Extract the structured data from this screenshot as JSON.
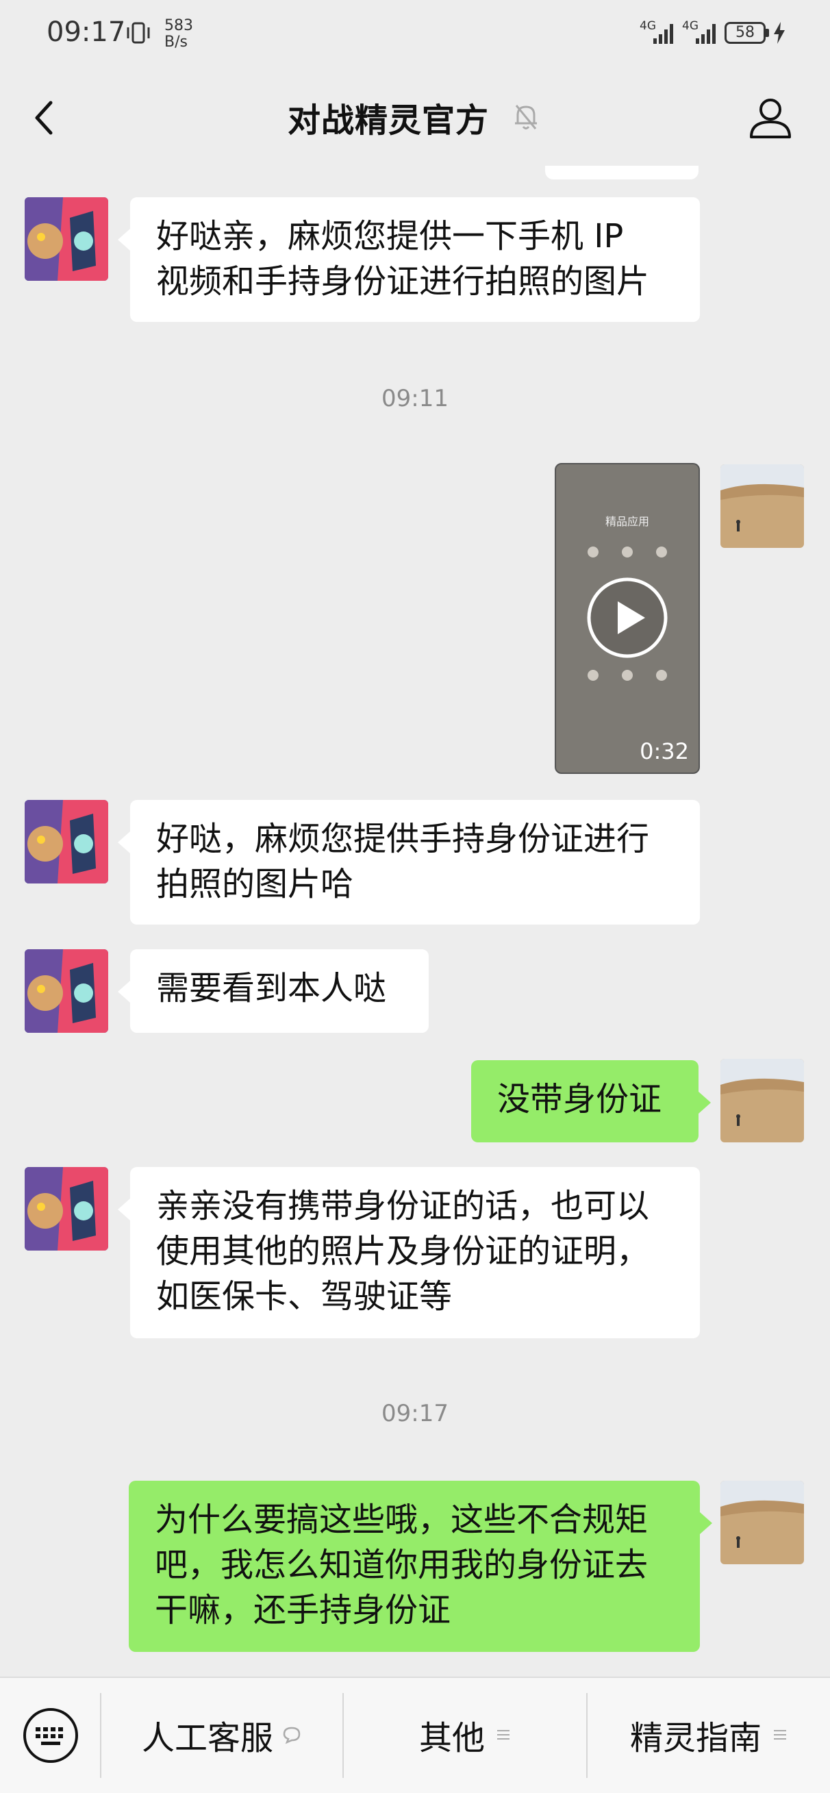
{
  "status_bar": {
    "time": "09:17",
    "speed_value": "583",
    "speed_unit": "B/s",
    "signal1_label": "4G",
    "signal2_label": "4G",
    "battery": "58"
  },
  "header": {
    "title": "对战精灵官方"
  },
  "messages": [
    {
      "from": "other",
      "text_lines": [
        "好哒亲，麻烦您提供一下手机 IP",
        "视频和手持身份证进行拍照的图片"
      ]
    },
    {
      "timestamp": "09:11"
    },
    {
      "from": "me",
      "type": "video",
      "screen_title": "精品应用",
      "duration": "0:32"
    },
    {
      "from": "other",
      "text_lines": [
        "好哒，麻烦您提供手持身份证进行",
        "拍照的图片哈"
      ]
    },
    {
      "from": "other",
      "text_lines": [
        "需要看到本人哒"
      ]
    },
    {
      "from": "me",
      "text_lines": [
        "没带身份证"
      ]
    },
    {
      "from": "other",
      "text_lines": [
        "亲亲没有携带身份证的话，也可以",
        "使用其他的照片及身份证的证明，",
        "如医保卡、驾驶证等"
      ]
    },
    {
      "timestamp": "09:17"
    },
    {
      "from": "me",
      "text_lines": [
        "为什么要搞这些哦，这些不合规矩",
        "吧，我怎么知道你用我的身份证去",
        "干嘛，还手持身份证"
      ]
    }
  ],
  "bottom_menu": {
    "items": [
      {
        "label": "人工客服",
        "mark": "speech-bubble-icon"
      },
      {
        "label": "其他",
        "mark": "menu-lines-icon"
      },
      {
        "label": "精灵指南",
        "mark": "menu-lines-icon"
      }
    ]
  },
  "colors": {
    "background": "#ededed",
    "incoming_bubble": "#ffffff",
    "outgoing_bubble": "#95ec69"
  }
}
